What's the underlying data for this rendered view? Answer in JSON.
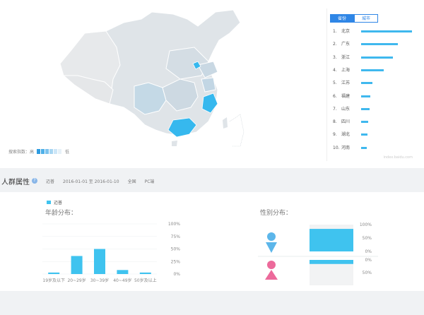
{
  "map_legend": {
    "high_label": "搜索指数：高",
    "low_label": "低"
  },
  "rank": {
    "tabs": [
      {
        "label": "省份",
        "active": true
      },
      {
        "label": "城市",
        "active": false
      }
    ],
    "items": [
      {
        "index": "1.",
        "name": "北京",
        "level": 1.0
      },
      {
        "index": "2.",
        "name": "广东",
        "level": 0.72
      },
      {
        "index": "3.",
        "name": "浙江",
        "level": 0.63
      },
      {
        "index": "4.",
        "name": "上海",
        "level": 0.44
      },
      {
        "index": "5.",
        "name": "江苏",
        "level": 0.22
      },
      {
        "index": "6.",
        "name": "福建",
        "level": 0.18
      },
      {
        "index": "7.",
        "name": "山东",
        "level": 0.16
      },
      {
        "index": "8.",
        "name": "四川",
        "level": 0.14
      },
      {
        "index": "9.",
        "name": "湖北",
        "level": 0.13
      },
      {
        "index": "10.",
        "name": "河南",
        "level": 0.11
      }
    ],
    "watermark": "index.baidu.com"
  },
  "section": {
    "title": "人群属性",
    "keyword": "迈普",
    "date_range": "2016-01-01 至 2016-01-10",
    "region": "全国",
    "device": "PC端"
  },
  "series_legend": "迈普",
  "age_chart": {
    "title": "年龄分布：",
    "chart_data": {
      "type": "bar",
      "categories": [
        "19岁及以下",
        "20~29岁",
        "30~39岁",
        "40~49岁",
        "50岁及以上"
      ],
      "values": [
        3,
        36,
        50,
        8,
        3
      ],
      "ylim": [
        0,
        100
      ],
      "yticks": [
        "0%",
        "25%",
        "50%",
        "75%",
        "100%"
      ]
    }
  },
  "gender_chart": {
    "title": "性别分布：",
    "chart_data": {
      "type": "bar",
      "categories": [
        "男",
        "女"
      ],
      "values": [
        84,
        16
      ],
      "ylim": [
        0,
        100
      ],
      "male_ticks": [
        "0%",
        "50%",
        "100%"
      ],
      "female_ticks": [
        "0%",
        "50%"
      ]
    }
  },
  "colors": {
    "bar": "#3fc3ef",
    "male": "#5cb6ea",
    "female": "#ec6a9b",
    "highlight_region": "#36b8ee"
  }
}
